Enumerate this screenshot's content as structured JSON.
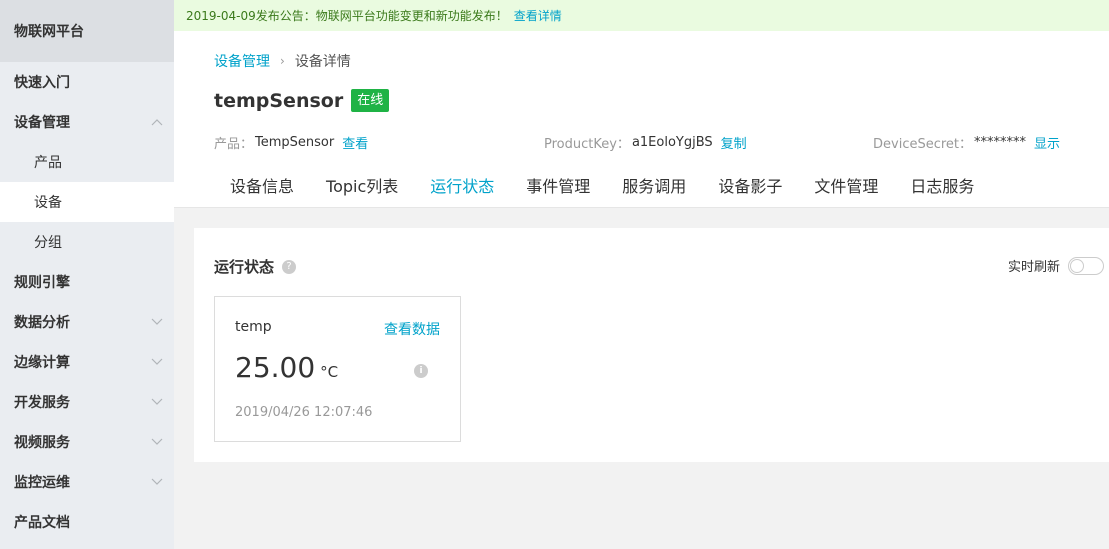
{
  "sidebar": {
    "header": "物联网平台",
    "items": [
      {
        "label": "快速入门",
        "sub": false,
        "chevron": "",
        "active": false
      },
      {
        "label": "设备管理",
        "sub": false,
        "chevron": "up",
        "active": false
      },
      {
        "label": "产品",
        "sub": true,
        "chevron": "",
        "active": false
      },
      {
        "label": "设备",
        "sub": true,
        "chevron": "",
        "active": true
      },
      {
        "label": "分组",
        "sub": true,
        "chevron": "",
        "active": false
      },
      {
        "label": "规则引擎",
        "sub": false,
        "chevron": "",
        "active": false
      },
      {
        "label": "数据分析",
        "sub": false,
        "chevron": "down",
        "active": false
      },
      {
        "label": "边缘计算",
        "sub": false,
        "chevron": "down",
        "active": false
      },
      {
        "label": "开发服务",
        "sub": false,
        "chevron": "down",
        "active": false
      },
      {
        "label": "视频服务",
        "sub": false,
        "chevron": "down",
        "active": false
      },
      {
        "label": "监控运维",
        "sub": false,
        "chevron": "down",
        "active": false
      },
      {
        "label": "产品文档",
        "sub": false,
        "chevron": "",
        "active": false
      }
    ]
  },
  "notice": {
    "message": "2019-04-09发布公告：物联网平台功能变更和新功能发布！",
    "link": "查看详情"
  },
  "breadcrumb": {
    "parent": "设备管理",
    "separator": "›",
    "current": "设备详情"
  },
  "device": {
    "name": "tempSensor",
    "status": "在线",
    "product_label": "产品：",
    "product_value": "TempSensor",
    "product_link": "查看",
    "productkey_label": "ProductKey：",
    "productkey_value": "a1EoloYgjBS",
    "productkey_link": "复制",
    "secret_label": "DeviceSecret：",
    "secret_value": "********",
    "secret_link": "显示"
  },
  "tabs": [
    {
      "label": "设备信息",
      "active": false
    },
    {
      "label": "Topic列表",
      "active": false
    },
    {
      "label": "运行状态",
      "active": true
    },
    {
      "label": "事件管理",
      "active": false
    },
    {
      "label": "服务调用",
      "active": false
    },
    {
      "label": "设备影子",
      "active": false
    },
    {
      "label": "文件管理",
      "active": false
    },
    {
      "label": "日志服务",
      "active": false
    }
  ],
  "panel": {
    "title": "运行状态",
    "help_icon": "?",
    "refresh_label": "实时刷新",
    "refresh_on": false
  },
  "card": {
    "name": "temp",
    "link": "查看数据",
    "value": "25.00",
    "unit": "°C",
    "info_icon": "i",
    "time": "2019/04/26 12:07:46"
  },
  "colors": {
    "accent": "#00a2ca",
    "online": "#1fb345",
    "notice_bg": "#eafbe0"
  }
}
